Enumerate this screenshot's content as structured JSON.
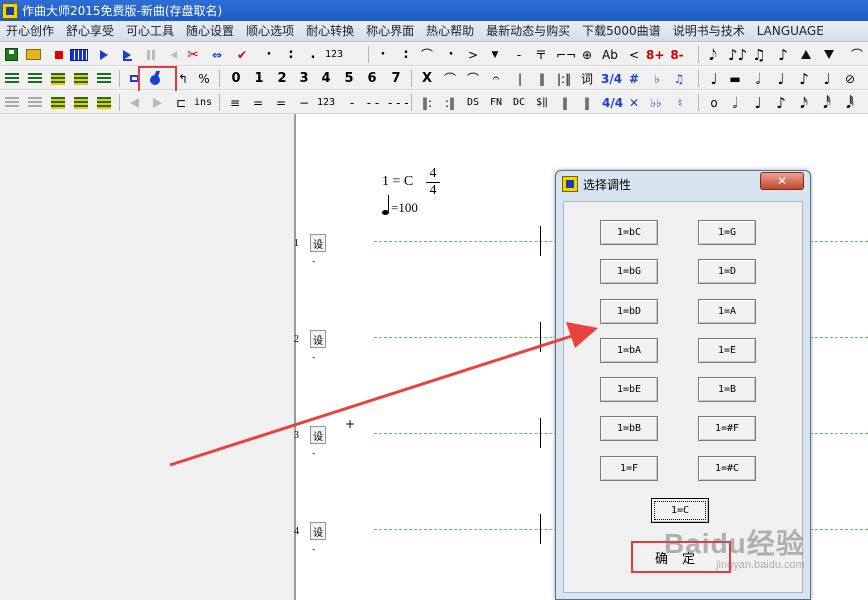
{
  "window": {
    "title": "作曲大师2015免费版-新曲(存盘取名)"
  },
  "menu": {
    "items": [
      "开心创作",
      "舒心享受",
      "可心工具",
      "随心设置",
      "顺心选项",
      "耐心转换",
      "称心界面",
      "热心帮助",
      "最新动态与购买",
      "下载5000曲谱",
      "说明书与技术",
      "LANGUAGE"
    ]
  },
  "toolbar1": {
    "labels": {
      "num123": "123",
      "ab": "Ab",
      "lt": "<",
      "eight_plus": "8+",
      "eight_minus": "8-",
      "ji": "ㄹ",
      "dots": ":",
      "dash": "-",
      "gt": ">",
      "tri": "▼",
      "circleplus": "⊕"
    }
  },
  "toolbar2": {
    "digits": [
      "0",
      "1",
      "2",
      "3",
      "4",
      "5",
      "6",
      "7"
    ],
    "labels": {
      "percent": "%",
      "x": "X",
      "ci": "词",
      "ts34": "3/4",
      "sharp": "#",
      "flat": "♭",
      "fermata": "𝄐"
    }
  },
  "toolbar3": {
    "labels": {
      "ins": "ins",
      "num123": "123",
      "ds": "DS",
      "fn": "FN",
      "dc": "DC",
      "dollar": "$‖",
      "ts44": "4/4",
      "x": "✕",
      "double_flat": "♭♭",
      "natural": "♮",
      "double_dash": "- -",
      "triple_dash": "- - -"
    }
  },
  "score": {
    "key_text": "1 = C",
    "time_sig_top": "4",
    "time_sig_bottom": "4",
    "tempo_text": "=100",
    "rows": [
      {
        "num": "1",
        "set": "设"
      },
      {
        "num": "2",
        "set": "设"
      },
      {
        "num": "3",
        "set": "设"
      },
      {
        "num": "4",
        "set": "设"
      }
    ],
    "row_dash": "-",
    "plus": "+"
  },
  "dialog": {
    "title": "选择调性",
    "close": "✕",
    "left_keys": [
      "1=bC",
      "1=bG",
      "1=bD",
      "1=bA",
      "1=bE",
      "1=bB",
      "1=F"
    ],
    "right_keys": [
      "1=G",
      "1=D",
      "1=A",
      "1=E",
      "1=B",
      "1=#F",
      "1=#C"
    ],
    "center_key": "1=C",
    "ok": "确定"
  },
  "watermark": {
    "main": "Baidu经验",
    "sub": "jingyan.baidu.com"
  },
  "colors": {
    "highlight": "#e23b3b",
    "titlebar": "#2d6fd6",
    "staff_dash": "#4ccd4c"
  }
}
